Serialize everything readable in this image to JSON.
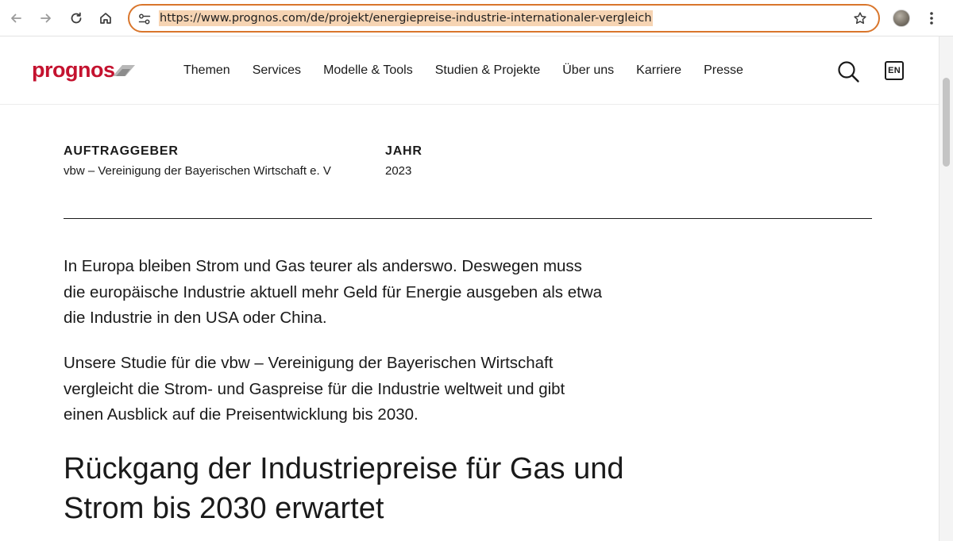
{
  "browser": {
    "url": "https://www.prognos.com/de/projekt/energiepreise-industrie-internationaler-vergleich"
  },
  "site": {
    "logo": "prognos",
    "brand_color": "#c4122f",
    "nav": [
      {
        "label": "Themen"
      },
      {
        "label": "Services"
      },
      {
        "label": "Modelle & Tools"
      },
      {
        "label": "Studien & Projekte"
      },
      {
        "label": "Über uns"
      },
      {
        "label": "Karriere"
      },
      {
        "label": "Presse"
      }
    ],
    "language_button": "EN"
  },
  "meta": {
    "client_label": "AUFTRAGGEBER",
    "client_value": "vbw – Vereinigung der Bayerischen Wirtschaft e. V",
    "year_label": "JAHR",
    "year_value": "2023"
  },
  "content": {
    "paragraph_1": "In Europa bleiben Strom und Gas teurer als anderswo. Deswegen muss die europäische Industrie aktuell mehr Geld für Energie ausgeben als etwa die Industrie in den USA oder China.",
    "paragraph_2": "Unsere Studie für die vbw – Vereinigung der Bayerischen Wirtschaft vergleicht die Strom- und Gaspreise für die Industrie weltweit und gibt einen Ausblick auf die Preisentwicklung bis 2030.",
    "heading": "Rückgang der Industriepreise für Gas und Strom bis 2030 erwartet"
  },
  "icons": {
    "back": "arrow-left-icon",
    "forward": "arrow-right-icon",
    "reload": "reload-icon",
    "home": "home-icon",
    "site_settings": "tune-icon",
    "bookmark": "star-icon",
    "menu": "kebab-icon",
    "search": "search-icon"
  }
}
